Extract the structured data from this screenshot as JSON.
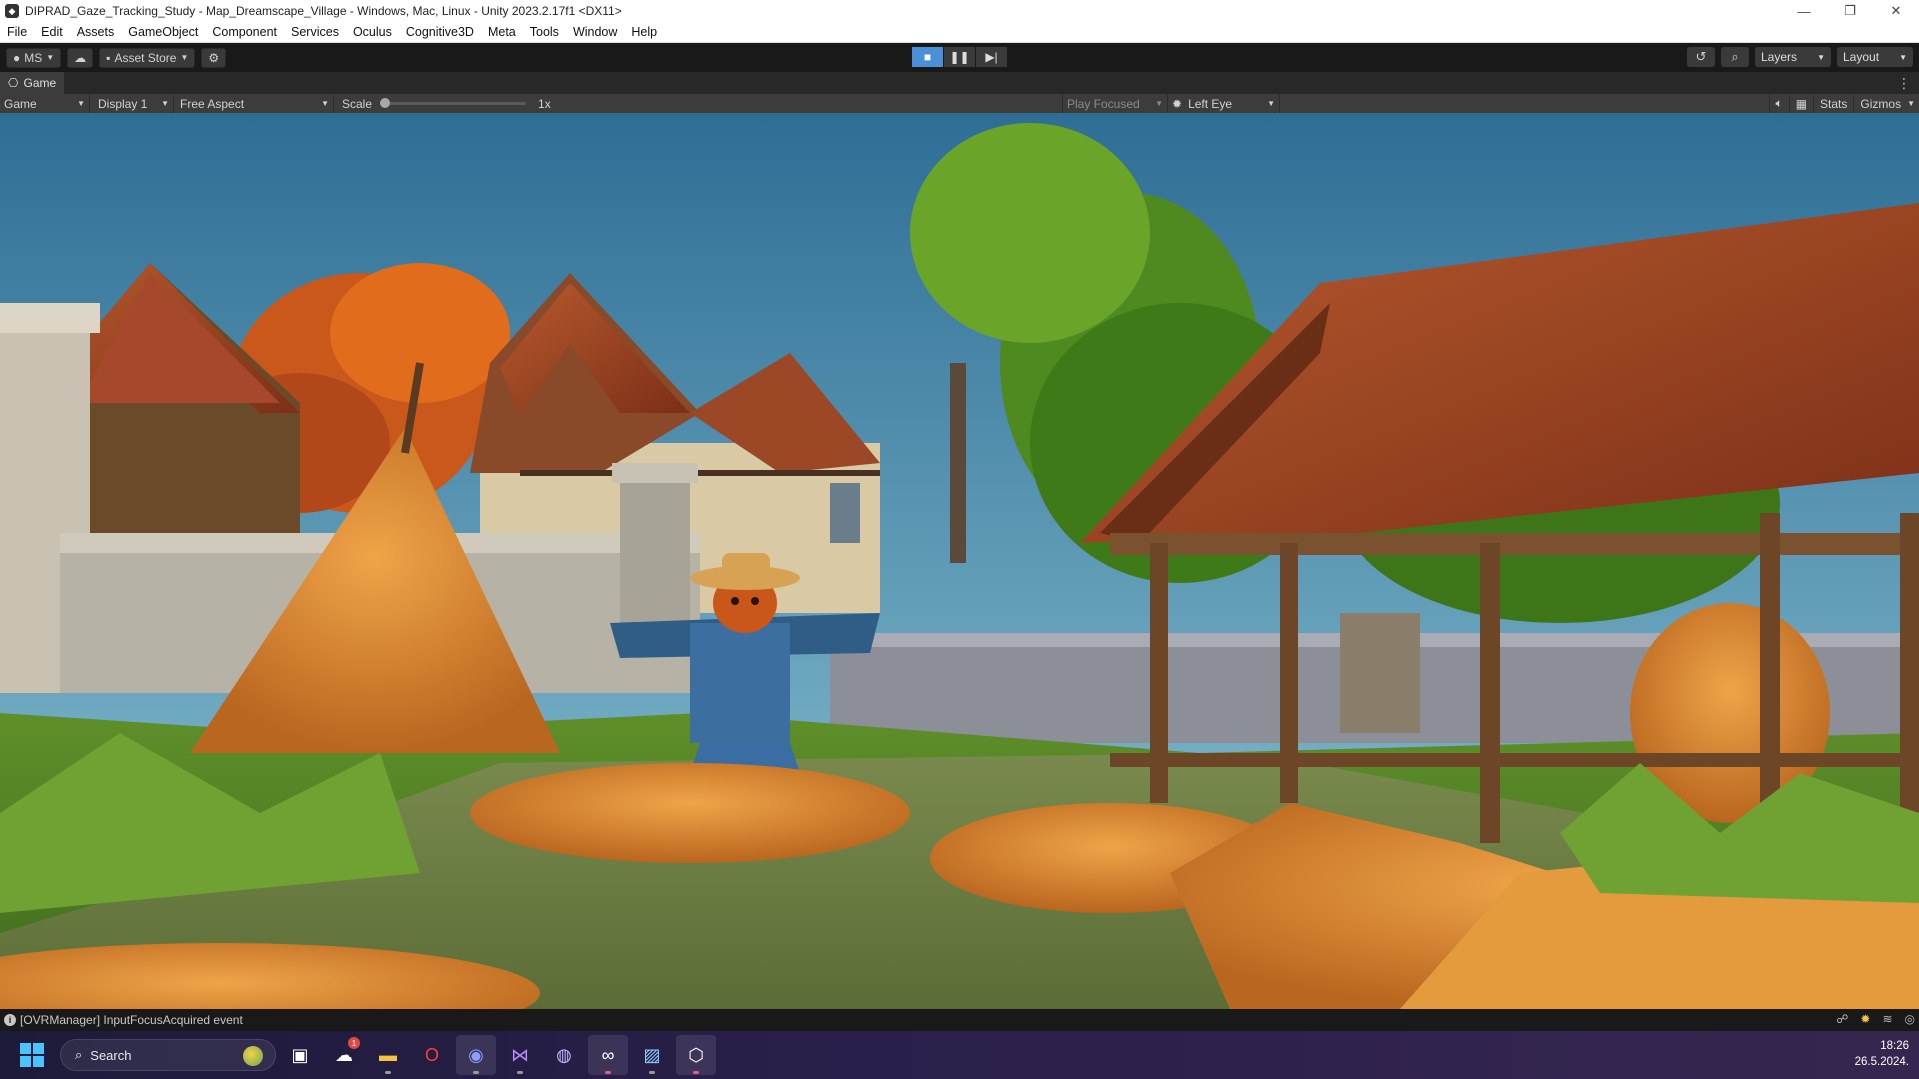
{
  "window": {
    "title": "DIPRAD_Gaze_Tracking_Study - Map_Dreamscape_Village - Windows, Mac, Linux - Unity 2023.2.17f1 <DX11>"
  },
  "menu": [
    "File",
    "Edit",
    "Assets",
    "GameObject",
    "Component",
    "Services",
    "Oculus",
    "Cognitive3D",
    "Meta",
    "Tools",
    "Window",
    "Help"
  ],
  "toolbar": {
    "account_label": "MS",
    "asset_store_label": "Asset Store",
    "layers_label": "Layers",
    "layout_label": "Layout"
  },
  "game_tab": {
    "label": "Game"
  },
  "game_toolbar": {
    "mode": "Game",
    "display": "Display 1",
    "aspect": "Free Aspect",
    "scale_label": "Scale",
    "scale_value": "1x",
    "scale_fraction": 0.0,
    "play_mode": "Play Focused",
    "eye": "Left Eye",
    "stats_label": "Stats",
    "gizmos_label": "Gizmos"
  },
  "console": {
    "message": "[OVRManager] InputFocusAcquired event"
  },
  "taskbar": {
    "search_placeholder": "Search",
    "apps": [
      {
        "name": "task-view",
        "icon": "task-view-icon"
      },
      {
        "name": "weather",
        "icon": "weather-icon",
        "badge": "1"
      },
      {
        "name": "file-explorer",
        "icon": "folder-icon"
      },
      {
        "name": "opera",
        "icon": "opera-icon"
      },
      {
        "name": "discord",
        "icon": "discord-icon"
      },
      {
        "name": "visual-studio",
        "icon": "visual-studio-icon"
      },
      {
        "name": "github-desktop",
        "icon": "github-icon"
      },
      {
        "name": "meta-quest-link",
        "icon": "meta-icon"
      },
      {
        "name": "photo-app",
        "icon": "photos-icon"
      },
      {
        "name": "unity",
        "icon": "unity-icon"
      }
    ],
    "time": "18:26",
    "date": "26.5.2024."
  },
  "colors": {
    "editor_bg": "#191919",
    "panel_bg": "#3c3c3c",
    "play_active": "#4a90d9",
    "sky": "#3b7fa8",
    "grass": "#5c8a2b",
    "roof": "#a34a25",
    "hay": "#d88a2c"
  }
}
